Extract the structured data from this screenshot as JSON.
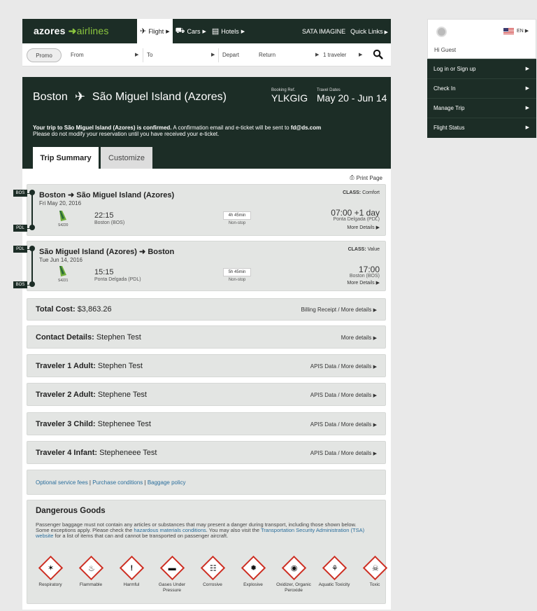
{
  "nav": {
    "logo_primary": "azores",
    "logo_secondary": "airlines",
    "tabs": [
      {
        "label": "Flight",
        "icon": "plane-icon"
      },
      {
        "label": "Cars",
        "icon": "car-icon"
      },
      {
        "label": "Hotels",
        "icon": "bed-icon"
      }
    ],
    "links": [
      "SATA IMAGINE",
      "Quick Links"
    ]
  },
  "search": {
    "promo": "Promo",
    "from": "From",
    "to": "To",
    "depart": "Depart",
    "return": "Return",
    "travelers": "1 traveler"
  },
  "hero": {
    "origin": "Boston",
    "destination": "São Miguel Island (Azores)",
    "booking_ref_label": "Booking Ref.",
    "booking_ref": "YLKGIG",
    "travel_dates_label": "Travel Dates",
    "travel_dates": "May 20 - Jun 14",
    "confirm_strong": "Your trip to São Miguel Island (Azores) is confirmed.",
    "confirm_text": " A confirmation email and e-ticket will be sent to ",
    "confirm_email": "fd@ds.com",
    "confirm_line2": "Please do not modify your reservation until you have received your e-ticket.",
    "tabs": [
      "Trip Summary",
      "Customize"
    ]
  },
  "print_label": "Print Page",
  "flights": [
    {
      "from": "Boston",
      "to": "São Miguel Island (Azores)",
      "date": "Fri May 20, 2016",
      "class_label": "CLASS:",
      "class": "Comfort",
      "flight_no": "S4220",
      "depart_time": "22:15",
      "depart_city": "Boston (BOS)",
      "duration": "4h 45min",
      "stops": "Non-stop",
      "arrive_time": "07:00 +1 day",
      "arrive_city": "Ponta Delgada (PDL)",
      "more": "More Details",
      "tag_start": "BOS",
      "tag_end": "PDL"
    },
    {
      "from": "São Miguel Island (Azores)",
      "to": "Boston",
      "date": "Tue Jun 14, 2016",
      "class_label": "CLASS:",
      "class": "Value",
      "flight_no": "S4221",
      "depart_time": "15:15",
      "depart_city": "Ponta Delgada (PDL)",
      "duration": "5h 45min",
      "stops": "Non-stop",
      "arrive_time": "17:00",
      "arrive_city": "Boston (BOS)",
      "more": "More Details",
      "tag_start": "PDL",
      "tag_end": "BOS"
    }
  ],
  "sections": [
    {
      "label": "Total Cost:",
      "value": "$3,863.26",
      "link": "Billing Receipt / More details"
    },
    {
      "label": "Contact Details:",
      "value": "Stephen Test",
      "link": "More details"
    },
    {
      "label": "Traveler 1 Adult:",
      "value": "Stephen Test",
      "link": "APIS Data / More details"
    },
    {
      "label": "Traveler 2 Adult:",
      "value": "Stephene Test",
      "link": "APIS Data / More details"
    },
    {
      "label": "Traveler 3 Child:",
      "value": "Stephenee Test",
      "link": "APIS Data / More details"
    },
    {
      "label": "Traveler 4 Infant:",
      "value": "Stepheneee Test",
      "link": "APIS Data / More details"
    }
  ],
  "policies": [
    "Optional service fees",
    "Purchase conditions",
    "Baggage policy"
  ],
  "dangerous": {
    "title": "Dangerous Goods",
    "text_1": "Passenger baggage must not contain any articles or substances that may present a danger during transport, including those shown below. Some exceptions apply. Please check the ",
    "link_1": "hazardous materials conditions",
    "text_2": ". You may also visit the ",
    "link_2": "Transportation Security Administration (TSA) website",
    "text_3": " for a list of items that can and cannot be transported on passenger aircraft.",
    "items": [
      {
        "label": "Respiratory",
        "icon": "respiratory-hazard-icon"
      },
      {
        "label": "Flammable",
        "icon": "flame-icon"
      },
      {
        "label": "Harmful",
        "icon": "exclamation-icon"
      },
      {
        "label": "Gases Under Pressure",
        "icon": "gas-cylinder-icon"
      },
      {
        "label": "Corrosive",
        "icon": "corrosive-icon"
      },
      {
        "label": "Explosive",
        "icon": "explosive-icon"
      },
      {
        "label": "Oxidizer, Organic Peroxide",
        "icon": "oxidizer-icon"
      },
      {
        "label": "Aquatic Toxicity",
        "icon": "aquatic-toxicity-icon"
      },
      {
        "label": "Toxic",
        "icon": "skull-icon"
      }
    ]
  },
  "sidebar": {
    "language": "EN",
    "greeting": "Hi Guest",
    "items": [
      "Log in or Sign up",
      "Check In",
      "Manage Trip",
      "Flight Status"
    ]
  },
  "colors": {
    "brand_dark": "#1c2d26",
    "brand_green": "#8cc63f",
    "hazard_red": "#cc2e22",
    "link_blue": "#2a6e9c"
  }
}
